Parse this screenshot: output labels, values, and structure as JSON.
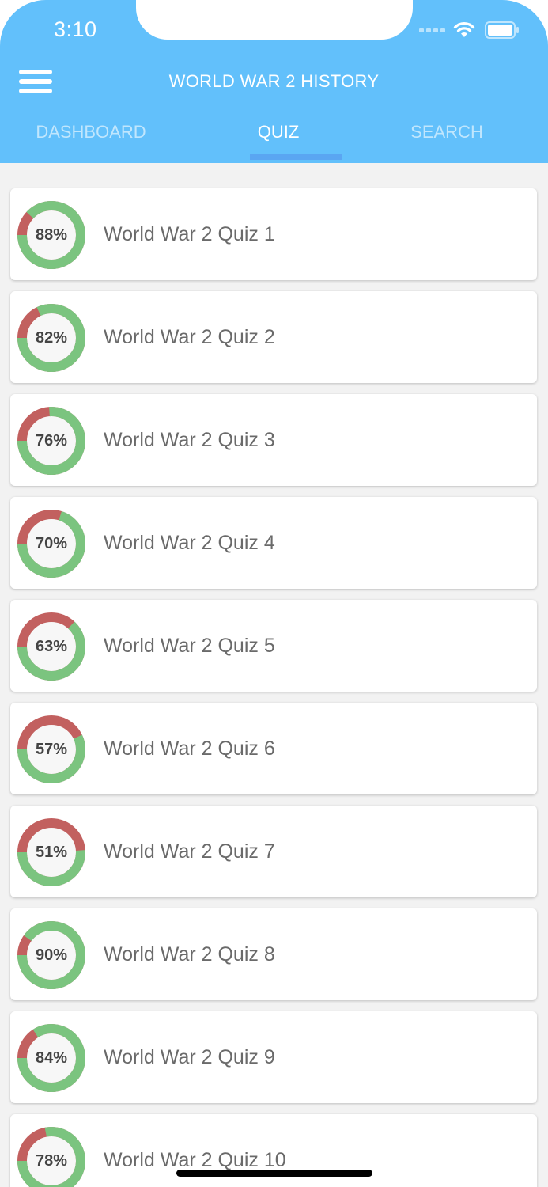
{
  "status_bar": {
    "time": "3:10",
    "icons": [
      "signal-icon",
      "wifi-icon",
      "battery-icon"
    ]
  },
  "header": {
    "title": "WORLD WAR 2 HISTORY",
    "menu_icon": "menu-icon"
  },
  "tabs": [
    {
      "label": "DASHBOARD",
      "active": false
    },
    {
      "label": "QUIZ",
      "active": true
    },
    {
      "label": "SEARCH",
      "active": false
    }
  ],
  "colors": {
    "header_bg": "#62c0fb",
    "tab_indicator": "#5aa6f2",
    "ring_correct": "#7bc47f",
    "ring_incorrect": "#c2605f",
    "ring_inner": "#f7f7f7"
  },
  "quizzes": [
    {
      "title": "World War 2 Quiz 1",
      "score_label": "88%",
      "score": 88
    },
    {
      "title": "World War 2 Quiz 2",
      "score_label": "82%",
      "score": 82
    },
    {
      "title": "World War 2 Quiz 3",
      "score_label": "76%",
      "score": 76
    },
    {
      "title": "World War 2 Quiz 4",
      "score_label": "70%",
      "score": 70
    },
    {
      "title": "World War 2 Quiz 5",
      "score_label": "63%",
      "score": 63
    },
    {
      "title": "World War 2 Quiz 6",
      "score_label": "57%",
      "score": 57
    },
    {
      "title": "World War 2 Quiz 7",
      "score_label": "51%",
      "score": 51
    },
    {
      "title": "World War 2 Quiz 8",
      "score_label": "90%",
      "score": 90
    },
    {
      "title": "World War 2 Quiz 9",
      "score_label": "84%",
      "score": 84
    },
    {
      "title": "World War 2 Quiz 10",
      "score_label": "78%",
      "score": 78
    }
  ]
}
